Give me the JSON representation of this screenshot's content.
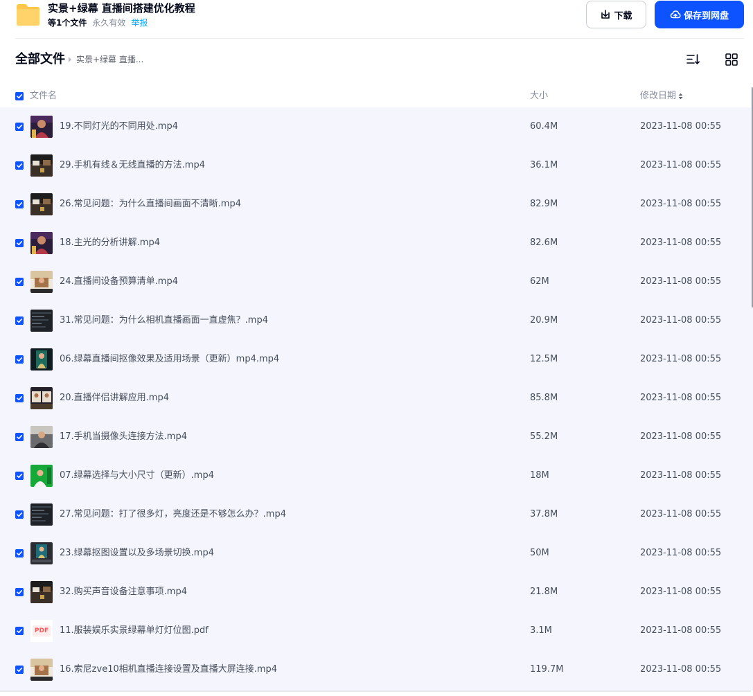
{
  "share": {
    "title": "实景+绿幕 直播间搭建优化教程",
    "file_count": "等1个文件",
    "validity": "永久有效",
    "report_label": "举报",
    "folder_icon": "folder-icon"
  },
  "actions": {
    "download_label": "下载",
    "download_icon": "download-icon",
    "save_label": "保存到网盘",
    "save_icon": "cloud-upload-icon"
  },
  "breadcrumb": {
    "root": "全部文件",
    "current": "实景+绿幕 直播..."
  },
  "toolbar": {
    "sort_icon": "sort-list-icon",
    "grid_icon": "grid-view-icon"
  },
  "columns": {
    "name": "文件名",
    "size": "大小",
    "date": "修改日期"
  },
  "colors": {
    "accent": "#0d53ff",
    "list_bg": "#f5f6fd",
    "link": "#06a7ff"
  },
  "files": [
    {
      "name": "19.不同灯光的不同用处.mp4",
      "size": "60.4M",
      "date": "2023-11-08 00:55",
      "thumb": "video-thumbnail-portrait",
      "checked": true
    },
    {
      "name": "29.手机有线＆无线直播的方法.mp4",
      "size": "36.1M",
      "date": "2023-11-08 00:55",
      "thumb": "video-thumbnail-desk",
      "checked": true
    },
    {
      "name": "26.常见问题：为什么直播间画面不清晰.mp4",
      "size": "82.9M",
      "date": "2023-11-08 00:55",
      "thumb": "video-thumbnail-desk",
      "checked": true
    },
    {
      "name": "18.主光的分析讲解.mp4",
      "size": "82.6M",
      "date": "2023-11-08 00:55",
      "thumb": "video-thumbnail-portrait",
      "checked": true
    },
    {
      "name": "24.直播间设备预算清单.mp4",
      "size": "62M",
      "date": "2023-11-08 00:55",
      "thumb": "video-thumbnail-room",
      "checked": true
    },
    {
      "name": "31.常见问题：为什么相机直播画面一直虚焦？.mp4",
      "size": "20.9M",
      "date": "2023-11-08 00:55",
      "thumb": "video-thumbnail-screen",
      "checked": true
    },
    {
      "name": "06.绿幕直播间抠像效果及适用场景（更新）mp4.mp4",
      "size": "12.5M",
      "date": "2023-11-08 00:55",
      "thumb": "video-thumbnail-greenscreen-dark",
      "checked": true
    },
    {
      "name": "20.直播伴侣讲解应用.mp4",
      "size": "85.8M",
      "date": "2023-11-08 00:55",
      "thumb": "video-thumbnail-dual",
      "checked": true
    },
    {
      "name": "17.手机当摄像头连接方法.mp4",
      "size": "55.2M",
      "date": "2023-11-08 00:55",
      "thumb": "video-thumbnail-person",
      "checked": true
    },
    {
      "name": "07.绿幕选择与大小尺寸（更新）.mp4",
      "size": "18M",
      "date": "2023-11-08 00:55",
      "thumb": "video-thumbnail-greenscreen",
      "checked": true
    },
    {
      "name": "27.常见问题：打了很多灯，亮度还是不够怎么办？.mp4",
      "size": "37.8M",
      "date": "2023-11-08 00:55",
      "thumb": "video-thumbnail-screen",
      "checked": true
    },
    {
      "name": "23.绿幕抠图设置以及多场景切换.mp4",
      "size": "50M",
      "date": "2023-11-08 00:55",
      "thumb": "video-thumbnail-software",
      "checked": true
    },
    {
      "name": "32.购买声音设备注意事项.mp4",
      "size": "21.8M",
      "date": "2023-11-08 00:55",
      "thumb": "video-thumbnail-desk",
      "checked": true
    },
    {
      "name": "11.服装娱乐实景绿幕单灯灯位图.pdf",
      "size": "3.1M",
      "date": "2023-11-08 00:55",
      "thumb": "pdf-icon",
      "pdf_label": "PDF",
      "checked": true
    },
    {
      "name": "16.索尼zve10相机直播连接设置及直播大屏连接.mp4",
      "size": "119.7M",
      "date": "2023-11-08 00:55",
      "thumb": "video-thumbnail-room",
      "checked": true
    }
  ]
}
